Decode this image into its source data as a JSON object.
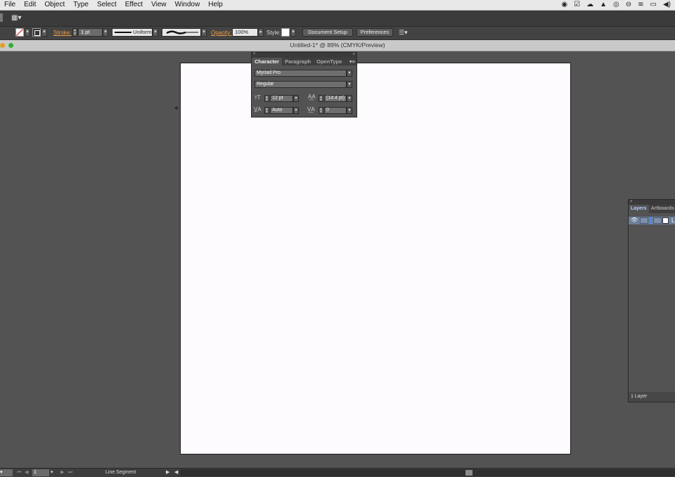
{
  "menubar": {
    "items": [
      "File",
      "Edit",
      "Object",
      "Type",
      "Select",
      "Effect",
      "View",
      "Window",
      "Help"
    ],
    "status_icons": [
      "record-icon",
      "check-icon",
      "cloud-icon",
      "drive-icon",
      "chrome-icon",
      "minus-circle-icon",
      "wifi-icon",
      "airplay-icon",
      "volume-icon"
    ]
  },
  "controlbar": {
    "stroke_label": "Stroke:",
    "stroke_weight": "1 pt",
    "profile_label": "Uniform",
    "opacity_label": "Opacity:",
    "opacity_value": "100%",
    "style_label": "Style:",
    "document_setup": "Document Setup",
    "preferences": "Preferences"
  },
  "document": {
    "title": "Untitled-1* @ 89% (CMYK/Preview)"
  },
  "character_panel": {
    "tabs": [
      "Character",
      "Paragraph",
      "OpenType"
    ],
    "font_family": "Myriad Pro",
    "font_style": "Regular",
    "font_size": "12 pt",
    "leading": "(14.4 pt)",
    "kerning": "Auto",
    "tracking": "0"
  },
  "layers_panel": {
    "tabs": [
      "Layers",
      "Artboards"
    ],
    "layer_name_initial": "L",
    "footer": "1 Layer"
  },
  "statusbar": {
    "artboard_number": "1",
    "tool": "Line Segment"
  },
  "colors": {
    "app_bg": "#535353",
    "accent_orange": "#f0a046",
    "layer_highlight": "#6b7e98"
  }
}
